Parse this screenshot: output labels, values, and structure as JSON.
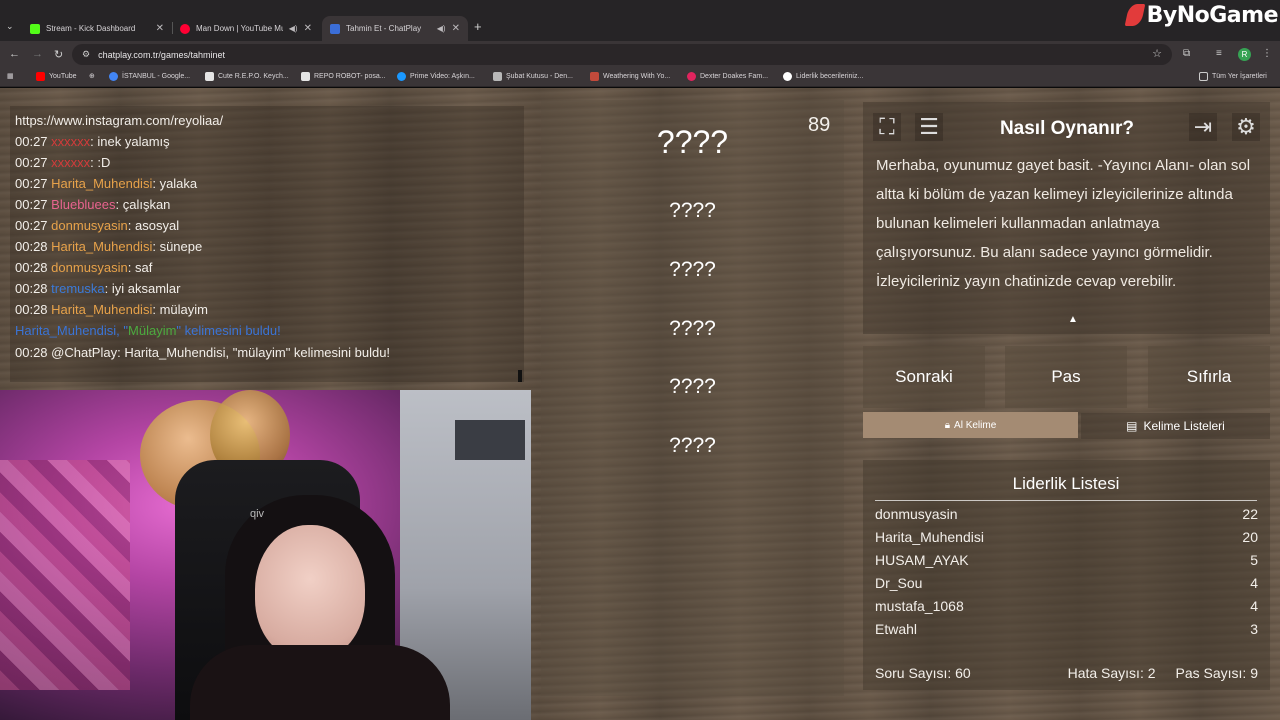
{
  "browser": {
    "tabs": [
      {
        "label": "Stream - Kick Dashboard",
        "favicon_color": "#53fc18"
      },
      {
        "label": "Man Down | YouTube Music",
        "favicon_color": "#ff0033"
      },
      {
        "label": "Tahmin Et - ChatPlay",
        "favicon_color": "#3b6ed8"
      }
    ],
    "brand": "ByNoGame",
    "url": "chatplay.com.tr/games/tahminet",
    "bookmarks": [
      "YouTube",
      "İSTANBUL - Google...",
      "Cute R.E.P.O. Keych...",
      "REPO ROBOT- posa...",
      "Prime Video: Aşkın...",
      "Şubat Kutusu - Den...",
      "Weathering With Yo...",
      "Dexter Doakes Fam...",
      "Liderlik becerileriniz...",
      "Tüm Yer İşaretleri"
    ],
    "profile_initial": "R"
  },
  "chat": {
    "link": "https://www.instagram.com/reyoliaa/",
    "lines": [
      {
        "time": "00:27",
        "user": "xxxxxx",
        "msg": ": inek yalamış"
      },
      {
        "time": "00:27",
        "user": "xxxxxx",
        "msg": ": :D"
      },
      {
        "time": "00:27",
        "user": "Harita_Muhendisi",
        "msg": ": yalaka"
      },
      {
        "time": "00:27",
        "user": "Bluebluees",
        "msg": ": çalışkan"
      },
      {
        "time": "00:27",
        "user": "donmusyasin",
        "msg": ": asosyal"
      },
      {
        "time": "00:28",
        "user": "Harita_Muhendisi",
        "msg": ": sünepe"
      },
      {
        "time": "00:28",
        "user": "donmusyasin",
        "msg": ": saf"
      },
      {
        "time": "00:28",
        "user": "tremuska",
        "msg": ": iyi aksamlar"
      },
      {
        "time": "00:28",
        "user": "Harita_Muhendisi",
        "msg": ": mülayim"
      }
    ],
    "system_pre": "Harita_Muhendisi, \"",
    "system_word": "Mülayim",
    "system_post": "\" kelimesini buldu!",
    "final": "00:28 @ChatPlay: Harita_Muhendisi, \"mülayim\" kelimesini buldu!"
  },
  "webcam": {
    "chair_text": "qiv"
  },
  "game": {
    "timer": "89",
    "main_word": "????",
    "hidden_words": [
      "????",
      "????",
      "????",
      "????",
      "????"
    ]
  },
  "howto": {
    "title": "Nasıl Oynanır?",
    "text": "Merhaba, oyunumuz gayet basit. -Yayıncı Alanı- olan sol altta ki bölüm de yazan kelimeyi izleyicilerinize altında bulunan kelimeleri kullanmadan anlatmaya çalışıyorsunuz. Bu alanı sadece yayıncı görmelidir. İzleyicileriniz yayın chatinizde cevap verebilir."
  },
  "controls": {
    "next": "Sonraki",
    "pass": "Pas",
    "reset": "Sıfırla",
    "take_word": "Al Kelime",
    "word_lists": "Kelime Listeleri"
  },
  "leaderboard": {
    "title": "Liderlik Listesi",
    "rows": [
      {
        "name": "donmusyasin",
        "score": "22"
      },
      {
        "name": "Harita_Muhendisi",
        "score": "20"
      },
      {
        "name": "HUSAM_AYAK",
        "score": "5"
      },
      {
        "name": "Dr_Sou",
        "score": "4"
      },
      {
        "name": "mustafa_1068",
        "score": "4"
      },
      {
        "name": "Etwahl",
        "score": "3"
      }
    ]
  },
  "stats": {
    "questions": "Soru Sayısı: 60",
    "errors": "Hata Sayısı: 2",
    "passes": "Pas Sayısı: 9"
  }
}
